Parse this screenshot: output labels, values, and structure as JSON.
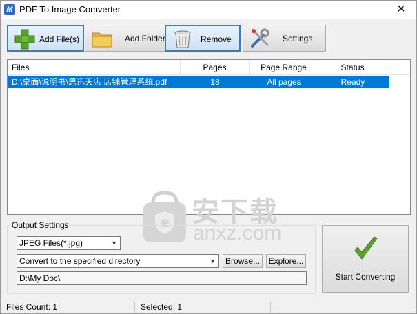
{
  "window": {
    "title": "PDF To Image Comverter"
  },
  "toolbar": {
    "add_files": "Add File(s)",
    "add_folder": "Add Folder",
    "remove": "Remove",
    "settings": "Settings"
  },
  "list": {
    "columns": [
      "Files",
      "Pages",
      "Page Range",
      "Status"
    ],
    "rows": [
      {
        "file": "D:\\桌面\\说明书\\思迅天店 店铺管理系统.pdf",
        "pages": "18",
        "range": "All pages",
        "status": "Ready"
      }
    ]
  },
  "watermark": {
    "text_cn": "安下载",
    "text_en": "anxz.com",
    "shield": "安"
  },
  "output": {
    "group_title": "Output Settings",
    "format": "JPEG Files(*.jpg)",
    "mode": "Convert to the specified directory",
    "browse": "Browse...",
    "explore": "Explore...",
    "path": "D:\\My Doc\\"
  },
  "start": {
    "label": "Start Converting"
  },
  "status": {
    "files_count": "Files Count: 1",
    "selected": "Selected: 1"
  },
  "colors": {
    "selection": "#0078d7",
    "accent_border": "#3a78c8",
    "checkmark": "#5aa02c"
  }
}
